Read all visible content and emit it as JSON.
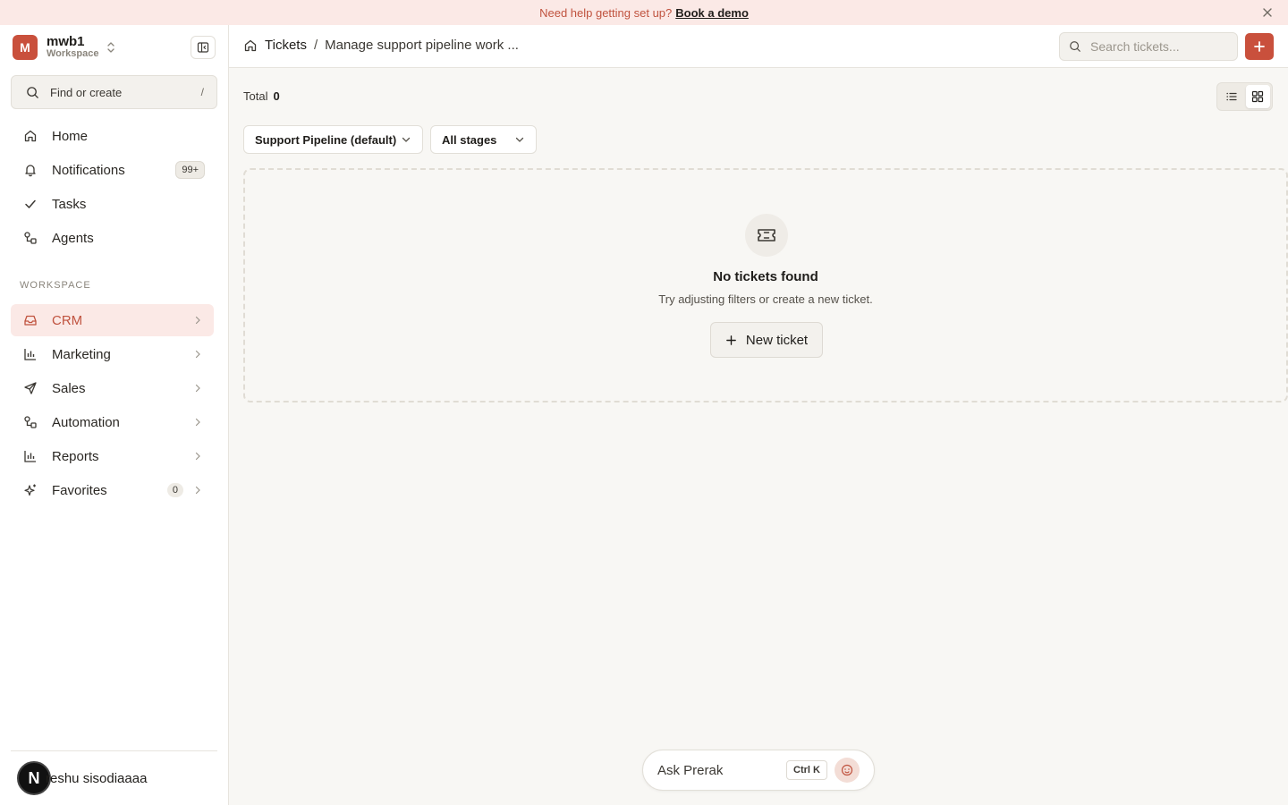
{
  "banner": {
    "text": "Need help getting set up?",
    "link": "Book a demo"
  },
  "workspace": {
    "initial": "M",
    "name": "mwb1",
    "subtitle": "Workspace"
  },
  "sidebar": {
    "find_label": "Find or create",
    "find_shortcut": "/",
    "items": [
      {
        "label": "Home",
        "icon": "home-icon"
      },
      {
        "label": "Notifications",
        "icon": "bell-icon",
        "badge": "99+"
      },
      {
        "label": "Tasks",
        "icon": "check-icon"
      },
      {
        "label": "Agents",
        "icon": "workflow-icon"
      }
    ],
    "section_label": "WORKSPACE",
    "workspace_items": [
      {
        "label": "CRM",
        "icon": "inbox-icon",
        "active": true
      },
      {
        "label": "Marketing",
        "icon": "bar-chart-icon"
      },
      {
        "label": "Sales",
        "icon": "send-icon"
      },
      {
        "label": "Automation",
        "icon": "workflow-icon"
      },
      {
        "label": "Reports",
        "icon": "bar-chart-icon"
      },
      {
        "label": "Favorites",
        "icon": "sparkles-icon",
        "badge": "0"
      }
    ],
    "user": {
      "initial": "N",
      "name": "reshu sisodiaaaa"
    }
  },
  "topbar": {
    "breadcrumb_root": "Tickets",
    "breadcrumb_sep": "/",
    "breadcrumb_page": "Manage support pipeline work ...",
    "search_placeholder": "Search tickets..."
  },
  "main": {
    "total_label": "Total",
    "total_value": "0",
    "pipeline_select": "Support Pipeline (default)",
    "stage_select": "All stages",
    "empty_title": "No tickets found",
    "empty_subtitle": "Try adjusting filters or create a new ticket.",
    "new_ticket_label": "New ticket"
  },
  "ask": {
    "label": "Ask Prerak",
    "shortcut": "Ctrl K"
  },
  "colors": {
    "accent": "#c9503c",
    "active_bg": "#fbe9e6",
    "banner_bg": "#fbe9e6"
  }
}
